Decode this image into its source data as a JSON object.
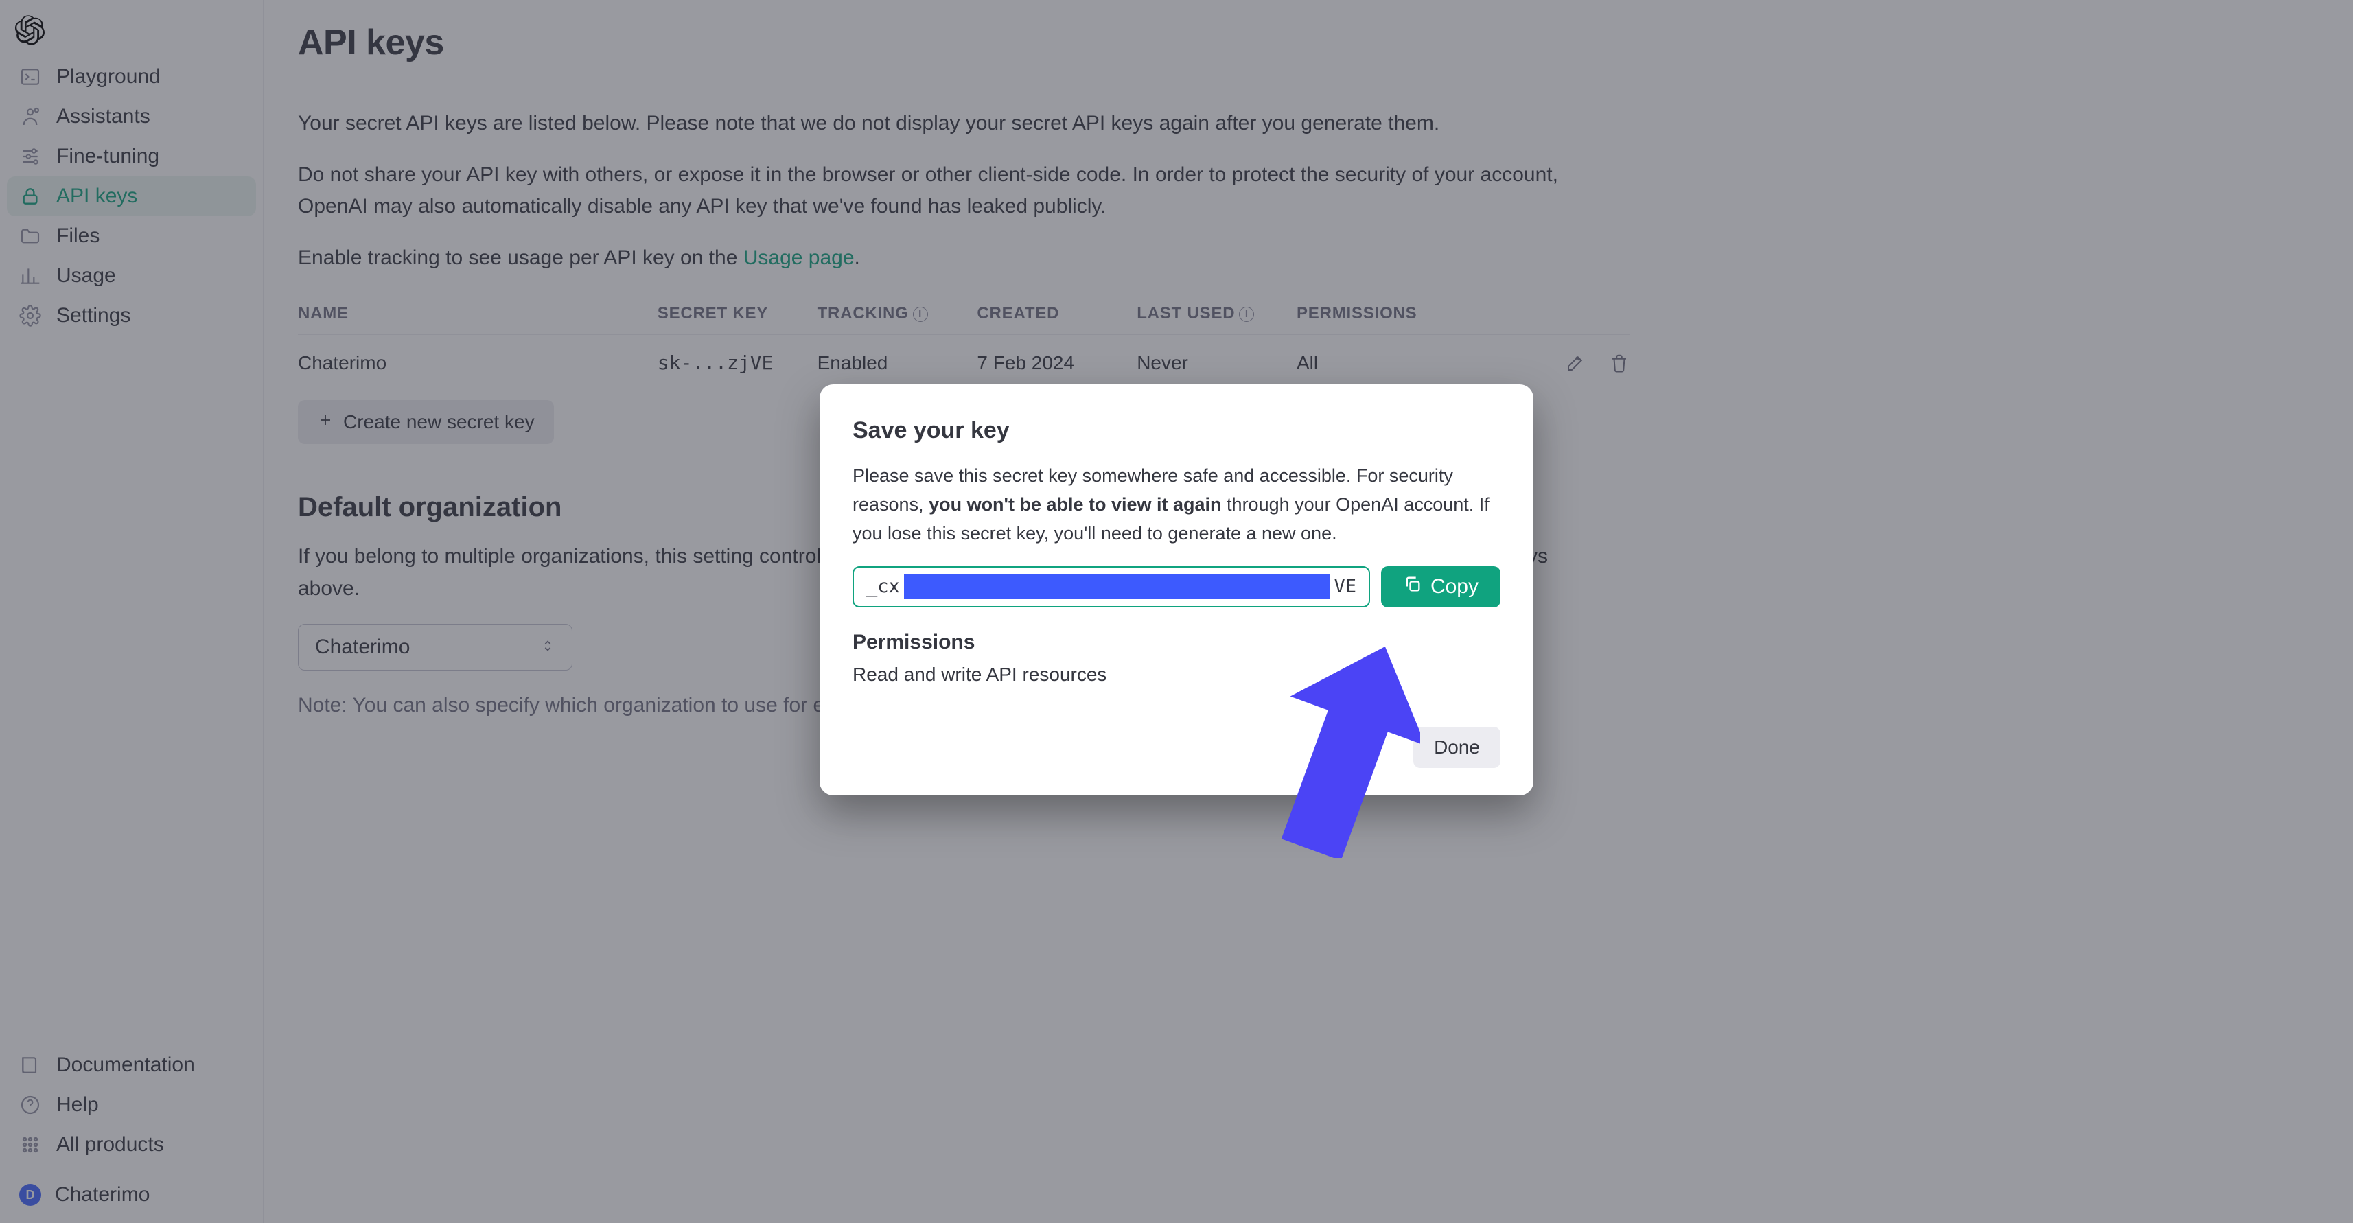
{
  "sidebar": {
    "items": [
      {
        "label": "Playground"
      },
      {
        "label": "Assistants"
      },
      {
        "label": "Fine-tuning"
      },
      {
        "label": "API keys"
      },
      {
        "label": "Files"
      },
      {
        "label": "Usage"
      },
      {
        "label": "Settings"
      }
    ],
    "footer": [
      {
        "label": "Documentation"
      },
      {
        "label": "Help"
      },
      {
        "label": "All products"
      }
    ],
    "workspace": {
      "initial": "D",
      "name": "Chaterimo"
    }
  },
  "page": {
    "title": "API keys",
    "intro1": "Your secret API keys are listed below. Please note that we do not display your secret API keys again after you generate them.",
    "intro2": "Do not share your API key with others, or expose it in the browser or other client-side code. In order to protect the security of your account, OpenAI may also automatically disable any API key that we've found has leaked publicly.",
    "tracking_prefix": "Enable tracking to see usage per API key on the ",
    "tracking_link": "Usage page",
    "tracking_suffix": ".",
    "columns": {
      "name": "Name",
      "secret": "Secret key",
      "tracking": "Tracking",
      "created": "Created",
      "last_used": "Last used",
      "permissions": "Permissions"
    },
    "rows": [
      {
        "name": "Chaterimo",
        "secret": "sk-...zjVE",
        "tracking": "Enabled",
        "created": "7 Feb 2024",
        "last_used": "Never",
        "permissions": "All"
      }
    ],
    "create_label": "Create new secret key",
    "org_heading": "Default organization",
    "org_text_prefix": "If you belong to multiple organizations, this setting controls which organization is used by default when making requests with the API keys above.",
    "org_text_suffix": "",
    "org_selected": "Chaterimo",
    "note": "Note: You can also specify which organization to use for each API request. See Authentication to learn more."
  },
  "modal": {
    "title": "Save your key",
    "text_prefix": "Please save this secret key somewhere safe and accessible. For security reasons, ",
    "text_bold": "you won't be able to view it again",
    "text_suffix": " through your OpenAI account. If you lose this secret key, you'll need to generate a new one.",
    "key_prefix": "_cx",
    "key_suffix": "VE",
    "copy": "Copy",
    "perm_heading": "Permissions",
    "perm_text": "Read and write API resources",
    "done": "Done"
  }
}
